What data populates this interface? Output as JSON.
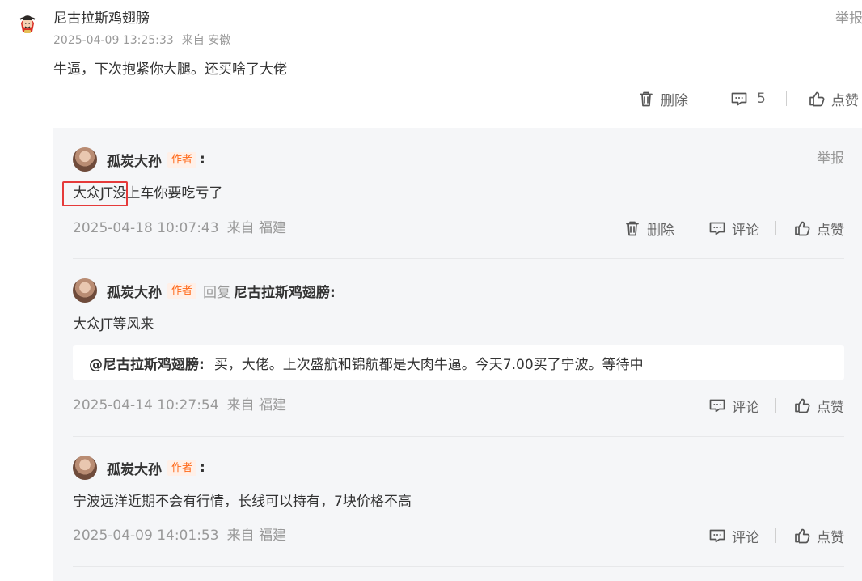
{
  "root_comment": {
    "author": "尼古拉斯鸡翅膀",
    "timestamp": "2025-04-09 13:25:33",
    "source": "来自 安徽",
    "text": "牛逼，下次抱紧你大腿。还买啥了大佬",
    "report": "举报",
    "actions": {
      "delete_label": "删除",
      "comment_count": "5",
      "like_label": "点赞"
    }
  },
  "replies": [
    {
      "author": "孤炭大孙",
      "badge": "作者",
      "colon": ":",
      "text": "大众JT没上车你要吃亏了",
      "timestamp": "2025-04-18 10:07:43",
      "source": "来自 福建",
      "report": "举报",
      "actions": {
        "delete_label": "删除",
        "comment_label": "评论",
        "like_label": "点赞"
      }
    },
    {
      "author": "孤炭大孙",
      "badge": "作者",
      "reply_word": "回复",
      "reply_to": "尼古拉斯鸡翅膀:",
      "text": "大众JT等风来",
      "quote": {
        "user": "@尼古拉斯鸡翅膀:",
        "text": "买，大佬。上次盛航和锦航都是大肉牛逼。今天7.00买了宁波。等待中"
      },
      "timestamp": "2025-04-14 10:27:54",
      "source": "来自 福建",
      "actions": {
        "comment_label": "评论",
        "like_label": "点赞"
      }
    },
    {
      "author": "孤炭大孙",
      "badge": "作者",
      "colon": ":",
      "text": "宁波远洋近期不会有行情，长线可以持有，7块价格不高",
      "timestamp": "2025-04-09 14:01:53",
      "source": "来自 福建",
      "actions": {
        "comment_label": "评论",
        "like_label": "点赞"
      }
    }
  ],
  "colors": {
    "panel_background": "#f5f6f8",
    "author_badge_text": "#ff6a1a",
    "author_badge_background": "#fff0e8",
    "highlight_border": "#e53a3a",
    "meta_text": "#999999"
  },
  "icons": {
    "delete": "trash-icon",
    "comment": "speech-bubble-icon",
    "like": "thumbs-up-icon"
  }
}
